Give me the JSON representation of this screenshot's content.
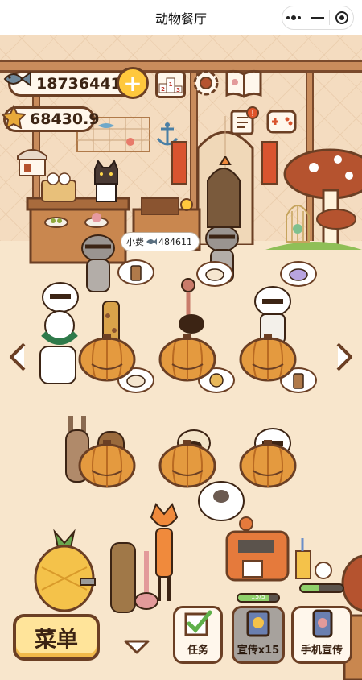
{
  "window": {
    "title": "动物餐厅",
    "capsule": {
      "more_icon": "more-dots-icon",
      "minimize_icon": "minimize-icon",
      "close_icon": "target-circle-icon"
    }
  },
  "hud": {
    "fish_coins": "18736441",
    "stars": "68430.9",
    "add_label": "+"
  },
  "tip": {
    "label": "小费",
    "amount": "484611"
  },
  "bottom": {
    "menu_label": "菜单",
    "task_label": "任务",
    "promo_label": "宣传x15",
    "promo_progress_text": "15/5",
    "promo_progress": 0.75,
    "phone_label": "手机宣传",
    "phone_progress": 0.45
  },
  "colors": {
    "outline": "#6b3f24",
    "pumpkin": "#e49a3f",
    "cream": "#fff7ec",
    "gold": "#ffc83d",
    "green": "#8fd16b"
  }
}
